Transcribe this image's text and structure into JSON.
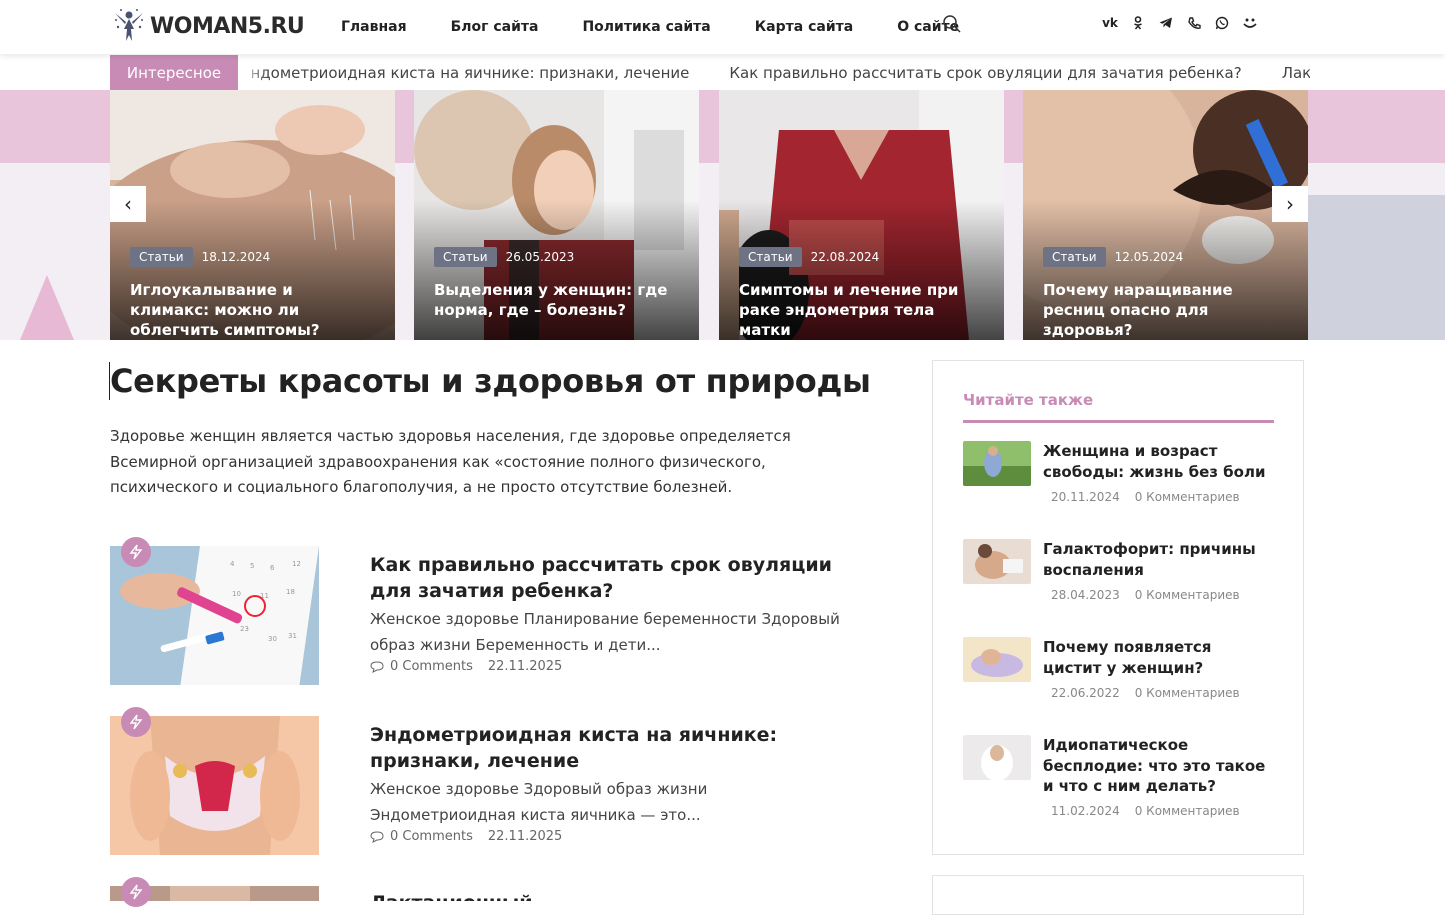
{
  "site": {
    "logo_text": "WOMAN5.RU"
  },
  "nav": [
    "Главная",
    "Блог сайта",
    "Политика сайта",
    "Карта сайта",
    "О сайте"
  ],
  "socials": [
    "vk-icon",
    "ok-icon",
    "telegram-icon",
    "viber-icon",
    "whatsapp-icon",
    "moimir-icon"
  ],
  "ticker": {
    "label": "Интересное",
    "items": [
      "Эндометриоидная киста на яичнике: признаки, лечение",
      "Как правильно рассчитать срок овуляции для зачатия ребенка?",
      "Лактационный"
    ]
  },
  "slider": {
    "cards": [
      {
        "badge": "Статьи",
        "date": "18.12.2024",
        "title": "Иглоукалывание и климакс: можно ли облегчить симптомы?"
      },
      {
        "badge": "Статьи",
        "date": "26.05.2023",
        "title": "Выделения у женщин: где норма, где – болезнь?"
      },
      {
        "badge": "Статьи",
        "date": "22.08.2024",
        "title": "Симптомы и лечение при раке эндометрия тела матки"
      },
      {
        "badge": "Статьи",
        "date": "12.05.2024",
        "title": "Почему наращивание ресниц опасно для здоровья?"
      }
    ],
    "prev": "‹",
    "next": "›"
  },
  "main": {
    "title": "Секреты красоты и здоровья от природы",
    "intro": "Здоровье женщин является частью здоровья населения, где здоровье определяется Всемирной организацией здравоохранения как «состояние полного физического, психического и социального благополучия, а не просто отсутствие болезней.",
    "posts": [
      {
        "title": "Как правильно рассчитать срок овуляции для зачатия ребенка?",
        "excerpt": "Женское здоровье Планирование беременности Здоровый образ жизни Беременность и дети...",
        "comments": "0 Comments",
        "date": "22.11.2025"
      },
      {
        "title": "Эндометриоидная киста на яичнике: признаки, лечение",
        "excerpt": "Женское здоровье Здоровый образ жизни Эндометриоидная киста яичника — это...",
        "comments": "0 Comments",
        "date": "22.11.2025"
      },
      {
        "title": "Лактационный",
        "excerpt": "",
        "comments": "",
        "date": ""
      }
    ]
  },
  "sidebar": {
    "heading": "Читайте также",
    "items": [
      {
        "title": "Женщина и возраст свободы: жизнь без боли",
        "date": "20.11.2024",
        "comments": "0 Комментариев"
      },
      {
        "title": "Галактофорит: причины воспаления",
        "date": "28.04.2023",
        "comments": "0 Комментариев"
      },
      {
        "title": "Почему появляется цистит у женщин?",
        "date": "22.06.2022",
        "comments": "0 Комментариев"
      },
      {
        "title": "Идиопатическое бесплодие: что это такое и что с ним делать?",
        "date": "11.02.2024",
        "comments": "0 Комментариев"
      }
    ]
  },
  "colors": {
    "accent": "#c78bb5",
    "badge": "#6d7384",
    "text": "#222222"
  }
}
